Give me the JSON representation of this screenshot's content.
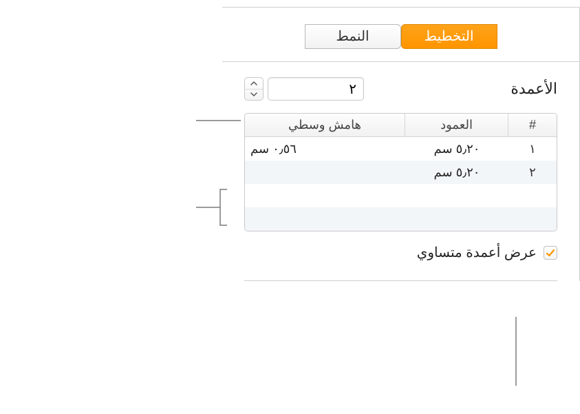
{
  "tabs": {
    "style": "النمط",
    "layout": "التخطيط"
  },
  "columns": {
    "label": "الأعمدة",
    "value": "٢",
    "table": {
      "headers": {
        "num": "#",
        "col": "العمود",
        "gutter": "هامش وسطي"
      },
      "rows": [
        {
          "num": "١",
          "col": "٥٫٢٠ سم",
          "gutter": "٠٫٥٦ سم"
        },
        {
          "num": "٢",
          "col": "٥٫٢٠ سم",
          "gutter": ""
        }
      ]
    },
    "equal_width_label": "عرض أعمدة متساوي"
  }
}
